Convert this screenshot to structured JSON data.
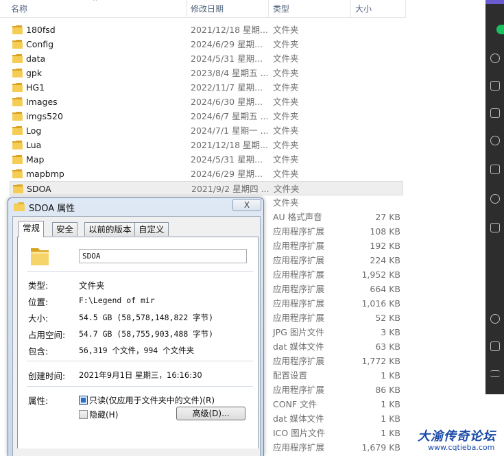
{
  "columns": {
    "name": "名称",
    "date": "修改日期",
    "type": "类型",
    "size": "大小"
  },
  "files": [
    {
      "name": "180fsd",
      "date": "2021/12/18 星期...",
      "type": "文件夹",
      "size": "",
      "folder": true
    },
    {
      "name": "Config",
      "date": "2024/6/29 星期...",
      "type": "文件夹",
      "size": "",
      "folder": true
    },
    {
      "name": "data",
      "date": "2024/5/31 星期...",
      "type": "文件夹",
      "size": "",
      "folder": true
    },
    {
      "name": "gpk",
      "date": "2023/8/4 星期五 ...",
      "type": "文件夹",
      "size": "",
      "folder": true
    },
    {
      "name": "HG1",
      "date": "2022/11/7 星期...",
      "type": "文件夹",
      "size": "",
      "folder": true
    },
    {
      "name": "Images",
      "date": "2024/6/30 星期...",
      "type": "文件夹",
      "size": "",
      "folder": true
    },
    {
      "name": "imgs520",
      "date": "2024/6/7 星期五 ...",
      "type": "文件夹",
      "size": "",
      "folder": true
    },
    {
      "name": "Log",
      "date": "2024/7/1 星期一 ...",
      "type": "文件夹",
      "size": "",
      "folder": true
    },
    {
      "name": "Lua",
      "date": "2021/12/18 星期...",
      "type": "文件夹",
      "size": "",
      "folder": true
    },
    {
      "name": "Map",
      "date": "2024/5/31 星期...",
      "type": "文件夹",
      "size": "",
      "folder": true
    },
    {
      "name": "mapbmp",
      "date": "2024/6/29 星期...",
      "type": "文件夹",
      "size": "",
      "folder": true
    },
    {
      "name": "SDOA",
      "date": "2021/9/2 星期四 ...",
      "type": "文件夹",
      "size": "",
      "folder": true,
      "selected": true
    },
    {
      "name": "",
      "date": "",
      "type": "文件夹",
      "size": "",
      "folder": false
    },
    {
      "name": "",
      "date": "",
      "type": "AU 格式声音",
      "size": "27 KB",
      "folder": false
    },
    {
      "name": "",
      "date": "",
      "type": "应用程序扩展",
      "size": "108 KB",
      "folder": false
    },
    {
      "name": "",
      "date": "",
      "type": "应用程序扩展",
      "size": "192 KB",
      "folder": false
    },
    {
      "name": "",
      "date": "",
      "type": "应用程序扩展",
      "size": "224 KB",
      "folder": false
    },
    {
      "name": "",
      "date": "",
      "type": "应用程序扩展",
      "size": "1,952 KB",
      "folder": false
    },
    {
      "name": "",
      "date": "",
      "type": "应用程序扩展",
      "size": "664 KB",
      "folder": false
    },
    {
      "name": "",
      "date": "",
      "type": "应用程序扩展",
      "size": "1,016 KB",
      "folder": false
    },
    {
      "name": "",
      "date": "",
      "type": "应用程序扩展",
      "size": "52 KB",
      "folder": false
    },
    {
      "name": "",
      "date": "",
      "type": "JPG 图片文件",
      "size": "3 KB",
      "folder": false
    },
    {
      "name": "",
      "date": "",
      "type": "dat 媒体文件",
      "size": "63 KB",
      "folder": false
    },
    {
      "name": "",
      "date": "",
      "type": "应用程序扩展",
      "size": "1,772 KB",
      "folder": false
    },
    {
      "name": "",
      "date": "",
      "type": "配置设置",
      "size": "1 KB",
      "folder": false
    },
    {
      "name": "",
      "date": "",
      "type": "应用程序扩展",
      "size": "86 KB",
      "folder": false
    },
    {
      "name": "",
      "date": "",
      "type": "CONF 文件",
      "size": "1 KB",
      "folder": false
    },
    {
      "name": "",
      "date": "",
      "type": "dat 媒体文件",
      "size": "1 KB",
      "folder": false
    },
    {
      "name": "",
      "date": "",
      "type": "ICO 图片文件",
      "size": "1 KB",
      "folder": false
    },
    {
      "name": "",
      "date": "",
      "type": "应用程序扩展",
      "size": "1,679 KB",
      "folder": false
    }
  ],
  "dialog": {
    "title": "SDOA 属性",
    "close_label": "X",
    "tabs": [
      "常规",
      "安全",
      "以前的版本",
      "自定义"
    ],
    "active_tab": "常规",
    "name_value": "SDOA",
    "fields": [
      {
        "label": "类型:",
        "value": "文件夹"
      },
      {
        "label": "位置:",
        "value": "F:\\Legend of mir"
      },
      {
        "label": "大小:",
        "value": "54.5 GB (58,578,148,822 字节)"
      },
      {
        "label": "占用空间:",
        "value": "54.7 GB (58,755,903,488 字节)"
      },
      {
        "label": "包含:",
        "value": "56,319 个文件，994 个文件夹"
      },
      {
        "label": "创建时间:",
        "value": "2021年9月1日 星期三，16:16:30"
      }
    ],
    "attributes_label": "属性:",
    "readonly_label": "只读(仅应用于文件夹中的文件)(R)",
    "readonly_checked": true,
    "hidden_label": "隐藏(H)",
    "hidden_checked": false,
    "advanced_label": "高级(D)..."
  },
  "watermark": {
    "title": "大渝传奇论坛",
    "url": "www.cqtieba.com"
  },
  "colors": {
    "accent": "#2a6fc5",
    "selection": "#eeeeee",
    "watermark": "#1a4aa8"
  }
}
